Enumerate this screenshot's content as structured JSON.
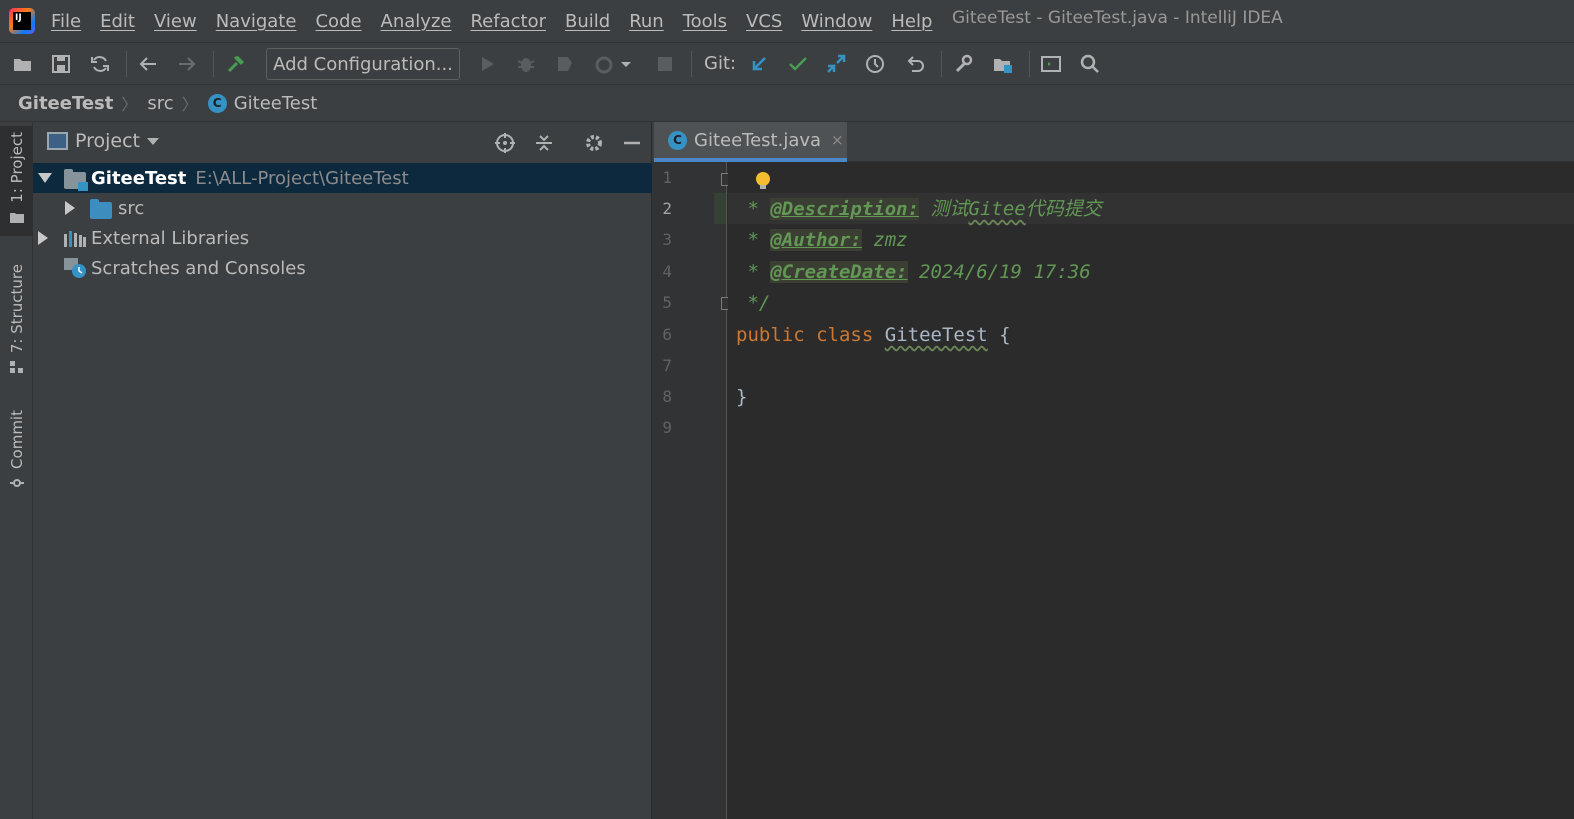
{
  "menubar": {
    "items": [
      "File",
      "Edit",
      "View",
      "Navigate",
      "Code",
      "Analyze",
      "Refactor",
      "Build",
      "Run",
      "Tools",
      "VCS",
      "Window",
      "Help"
    ],
    "window_title": "GiteeTest - GiteeTest.java - IntelliJ IDEA"
  },
  "toolbar": {
    "add_configuration": "Add Configuration...",
    "git_label": "Git:",
    "icons": [
      "open-icon",
      "save-icon",
      "sync-icon",
      "back-icon",
      "forward-icon",
      "build-hammer-icon",
      "run-icon",
      "debug-icon",
      "coverage-icon",
      "profile-icon",
      "stop-icon",
      "git-update-icon",
      "git-commit-icon",
      "git-push-icon",
      "history-icon",
      "rollback-icon",
      "settings-wrench-icon",
      "project-structure-icon",
      "terminal-icon",
      "search-icon"
    ],
    "colors": {
      "git_update": "#3592c4",
      "git_commit": "#499c54",
      "build": "#499c54"
    }
  },
  "breadcrumb": {
    "root": "GiteeTest",
    "folder": "src",
    "class_icon": "C",
    "class_name": "GiteeTest"
  },
  "left_strip": {
    "tabs": [
      "1: Project",
      "7: Structure",
      "Commit"
    ]
  },
  "project_panel": {
    "title": "Project",
    "tree": [
      {
        "label": "GiteeTest",
        "path": "E:\\ALL-Project\\GiteeTest",
        "expanded": true,
        "selected": true
      },
      {
        "label": "src",
        "expanded": false
      },
      {
        "label": "External Libraries",
        "expanded": false
      },
      {
        "label": "Scratches and Consoles"
      }
    ]
  },
  "editor": {
    "tab_label": "GiteeTest.java",
    "tab_icon": "C",
    "tab_close": "×",
    "current_line": 2,
    "line_numbers": [
      "1",
      "2",
      "3",
      "4",
      "5",
      "6",
      "7",
      "8",
      "9"
    ],
    "lines": {
      "l1": "/*",
      "l2_prefix": " * ",
      "l2_tag": "@Description:",
      "l2_text_a": " 测试",
      "l2_text_b": "Gitee",
      "l2_text_c": "代码提交",
      "l3_prefix": " * ",
      "l3_tag": "@Author:",
      "l3_text": " zmz",
      "l4_prefix": " * ",
      "l4_tag": "@CreateDate:",
      "l4_text": " 2024/6/19 17:36",
      "l5": " */",
      "l6_kw1": "public",
      "l6_kw2": "class",
      "l6_cls": "GiteeTest",
      "l6_brace": " {",
      "l8": "}"
    }
  }
}
